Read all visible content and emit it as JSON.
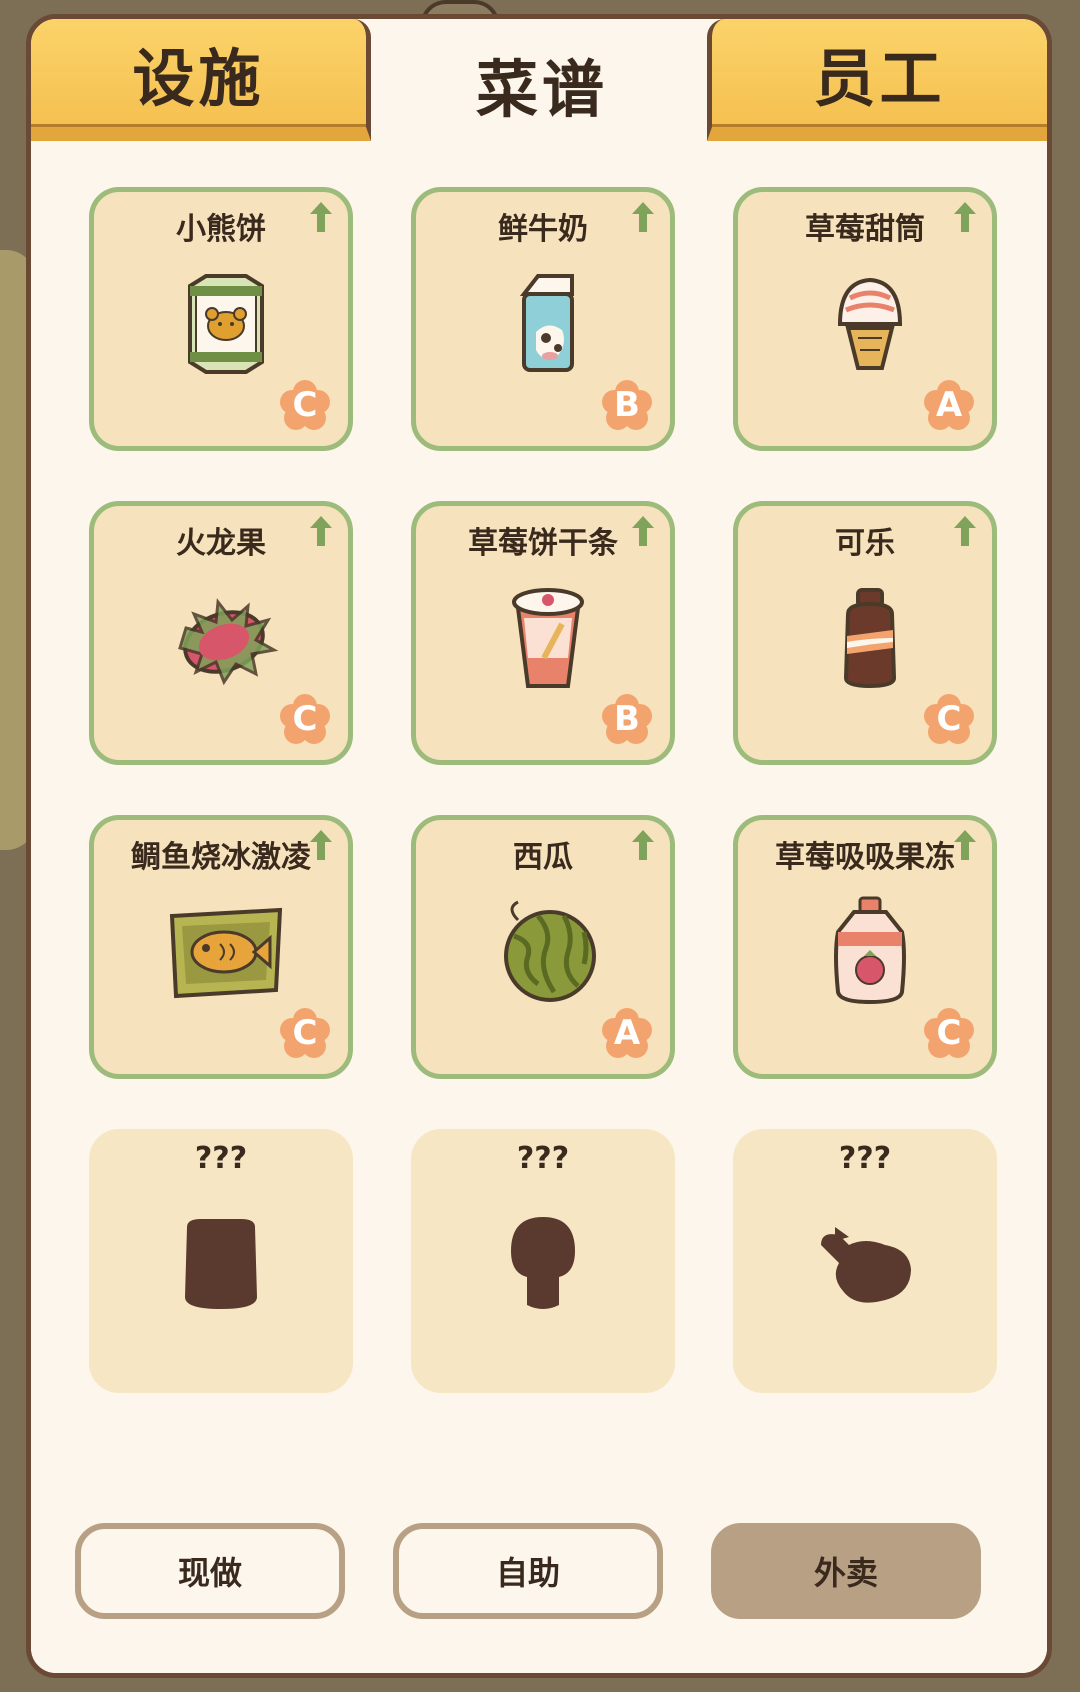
{
  "tabs": [
    {
      "label": "设施"
    },
    {
      "label": "菜谱"
    },
    {
      "label": "员工"
    }
  ],
  "active_tab": "菜谱",
  "recipes": [
    {
      "name": "小熊饼",
      "grade": "C",
      "icon": "bear-biscuit-tin-icon",
      "upgradable": true
    },
    {
      "name": "鲜牛奶",
      "grade": "B",
      "icon": "milk-carton-icon",
      "upgradable": true
    },
    {
      "name": "草莓甜筒",
      "grade": "A",
      "icon": "ice-cream-cone-icon",
      "upgradable": true
    },
    {
      "name": "火龙果",
      "grade": "C",
      "icon": "dragon-fruit-icon",
      "upgradable": true
    },
    {
      "name": "草莓饼干条",
      "grade": "B",
      "icon": "biscuit-stick-cup-icon",
      "upgradable": true
    },
    {
      "name": "可乐",
      "grade": "C",
      "icon": "cola-bottle-icon",
      "upgradable": true
    },
    {
      "name": "鲷鱼烧冰激凌",
      "grade": "C",
      "icon": "taiyaki-ice-cream-icon",
      "upgradable": true
    },
    {
      "name": "西瓜",
      "grade": "A",
      "icon": "watermelon-icon",
      "upgradable": true
    },
    {
      "name": "草莓吸吸果冻",
      "grade": "C",
      "icon": "jelly-pouch-icon",
      "upgradable": true
    }
  ],
  "locked": [
    {
      "name": "???"
    },
    {
      "name": "???"
    },
    {
      "name": "???"
    },
    {
      "name": "???"
    },
    {
      "name": "???"
    },
    {
      "name": "???"
    }
  ],
  "modes": [
    {
      "label": "现做"
    },
    {
      "label": "自助"
    },
    {
      "label": "外卖"
    }
  ],
  "active_mode": "外卖",
  "colors": {
    "panel_border": "#6b4a35",
    "tab_yellow": "#fbd36a",
    "card_border": "#9dbb7a",
    "card_bg": "#f6e3bd",
    "grade_badge": "#f3a46e",
    "upgrade_arrow": "#7fa35a",
    "locked_silhouette": "#5a3a2e"
  }
}
